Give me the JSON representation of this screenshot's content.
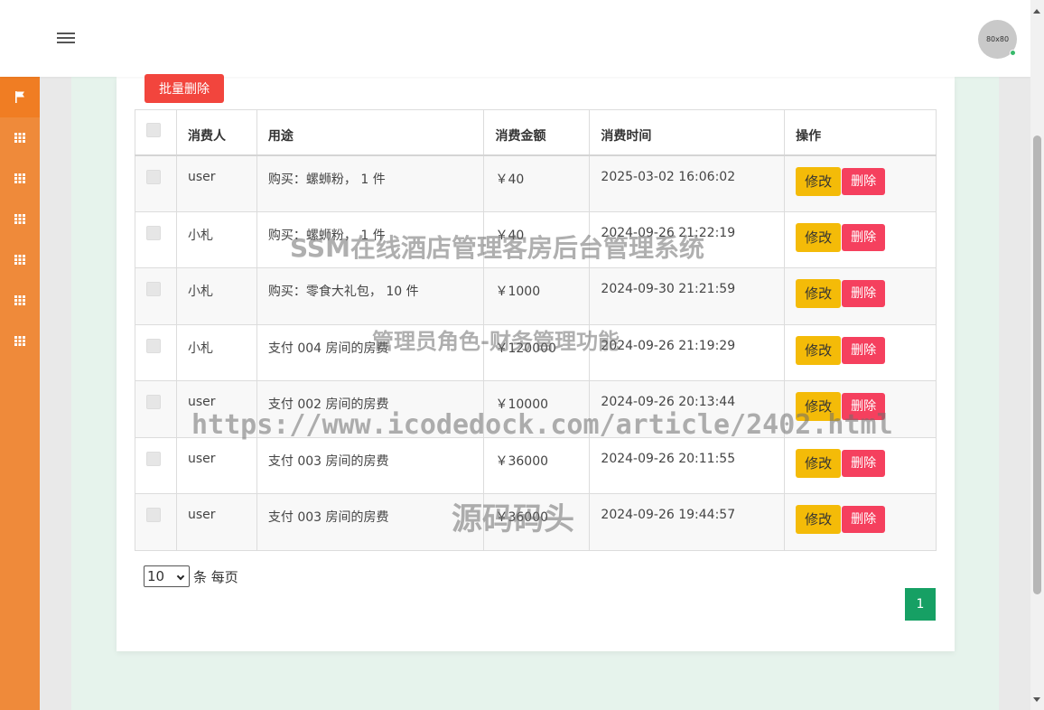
{
  "topbar": {
    "avatar_text": "80x80"
  },
  "sidebar": {
    "items": [
      {
        "icon": "flag-icon"
      },
      {
        "icon": "grid-icon"
      },
      {
        "icon": "grid-icon"
      },
      {
        "icon": "grid-icon"
      },
      {
        "icon": "grid-icon"
      },
      {
        "icon": "grid-icon"
      },
      {
        "icon": "grid-icon"
      }
    ]
  },
  "toolbar": {
    "batch_delete_label": "批量删除"
  },
  "table": {
    "headers": {
      "payer": "消费人",
      "purpose": "用途",
      "amount": "消费金额",
      "time": "消费时间",
      "actions": "操作"
    },
    "rows": [
      {
        "payer": "user",
        "purpose": "购买：螺蛳粉， 1 件",
        "amount": "￥40",
        "time": "2025-03-02 16:06:02",
        "edit": "修改",
        "delete": "删除"
      },
      {
        "payer": "小札",
        "purpose": "购买：螺蛳粉， 1 件",
        "amount": "￥40",
        "time": "2024-09-26 21:22:19",
        "edit": "修改",
        "delete": "删除"
      },
      {
        "payer": "小札",
        "purpose": "购买：零食大礼包， 10 件",
        "amount": "￥1000",
        "time": "2024-09-30 21:21:59",
        "edit": "修改",
        "delete": "删除"
      },
      {
        "payer": "小札",
        "purpose": "支付 004 房间的房费",
        "amount": "￥120000",
        "time": "2024-09-26 21:19:29",
        "edit": "修改",
        "delete": "删除"
      },
      {
        "payer": "user",
        "purpose": "支付 002 房间的房费",
        "amount": "￥10000",
        "time": "2024-09-26 20:13:44",
        "edit": "修改",
        "delete": "删除"
      },
      {
        "payer": "user",
        "purpose": "支付 003 房间的房费",
        "amount": "￥36000",
        "time": "2024-09-26 20:11:55",
        "edit": "修改",
        "delete": "删除"
      },
      {
        "payer": "user",
        "purpose": "支付 003 房间的房费",
        "amount": "￥36000",
        "time": "2024-09-26 19:44:57",
        "edit": "修改",
        "delete": "删除"
      }
    ]
  },
  "pagination": {
    "page_size_value": "10",
    "page_size_suffix": "条 每页",
    "current_page": "1"
  },
  "watermark": {
    "line1": "SSM在线酒店管理客房后台管理系统",
    "line2": "管理员角色-财务管理功能",
    "line3": "https://www.icodedock.com/article/2402.html",
    "line4": "源码码头"
  },
  "colors": {
    "sidebar": "#ef8a3a",
    "batch_delete": "#f2453d",
    "edit": "#f4bb08",
    "delete": "#f5405e",
    "pager_active": "#16a064"
  }
}
